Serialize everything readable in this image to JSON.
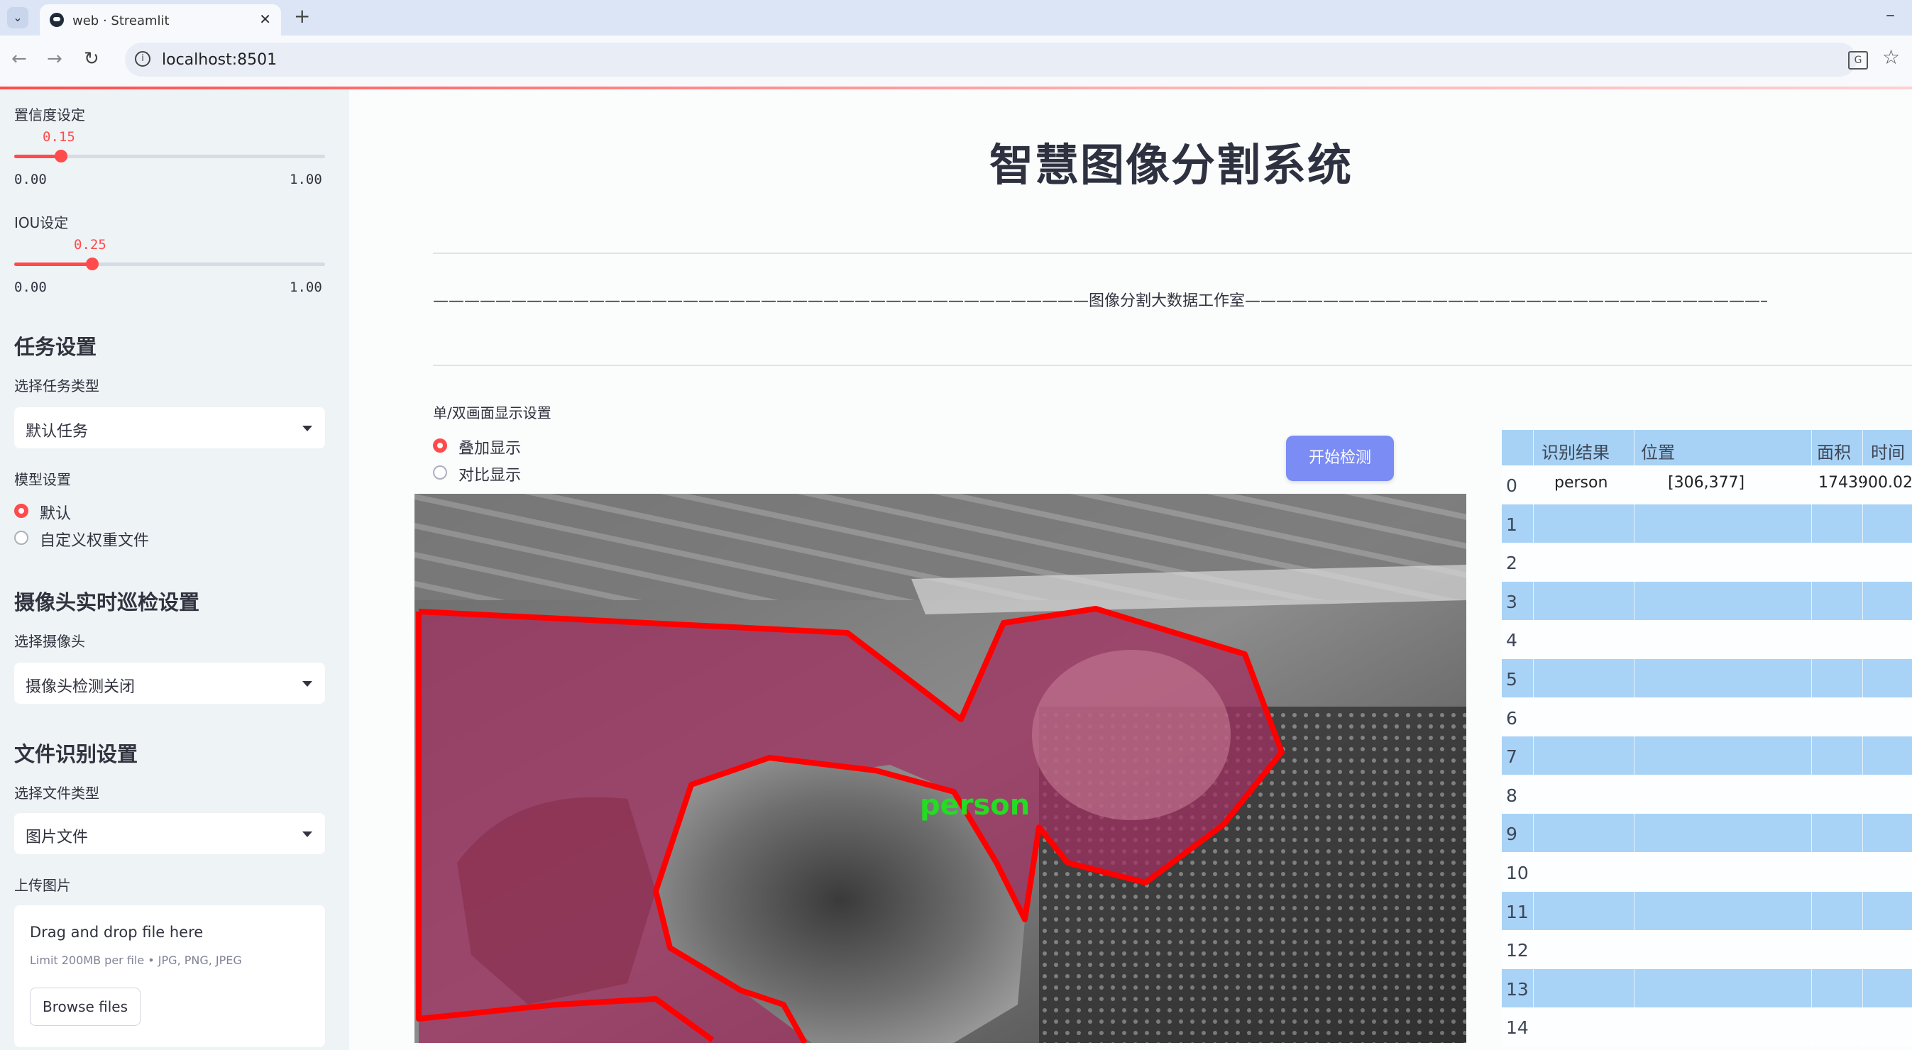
{
  "browser": {
    "tab_title": "web · Streamlit",
    "url": "localhost:8501"
  },
  "sidebar": {
    "confidence": {
      "label": "置信度设定",
      "value": "0.15",
      "min": "0.00",
      "max": "1.00",
      "fraction": 0.15
    },
    "iou": {
      "label": "IOU设定",
      "value": "0.25",
      "min": "0.00",
      "max": "1.00",
      "fraction": 0.25
    },
    "task_header": "任务设置",
    "task_type_label": "选择任务类型",
    "task_type_value": "默认任务",
    "model_label": "模型设置",
    "model_options": [
      "默认",
      "自定义权重文件"
    ],
    "camera_header": "摄像头实时巡检设置",
    "camera_label": "选择摄像头",
    "camera_value": "摄像头检测关闭",
    "file_header": "文件识别设置",
    "file_type_label": "选择文件类型",
    "file_type_value": "图片文件",
    "upload_label": "上传图片",
    "upload_title": "Drag and drop file here",
    "upload_sub": "Limit 200MB per file • JPG, PNG, JPEG",
    "browse_label": "Browse files"
  },
  "main": {
    "title": "智慧图像分割系统",
    "studio_line": "——————————————————————————————————————————图像分割大数据工作室——————————————————————————————————————————",
    "display_label": "单/双画面显示设置",
    "display_options": [
      "叠加显示",
      "对比显示"
    ],
    "start_button": "开始检测",
    "detection_label": "person"
  },
  "table": {
    "columns": [
      "识别结果",
      "位置",
      "面积",
      "时间"
    ],
    "rows": [
      {
        "idx": "0",
        "result": "person",
        "position": "[306,377]",
        "area": "1743900.02"
      },
      {
        "idx": "1"
      },
      {
        "idx": "2"
      },
      {
        "idx": "3"
      },
      {
        "idx": "4"
      },
      {
        "idx": "5"
      },
      {
        "idx": "6"
      },
      {
        "idx": "7"
      },
      {
        "idx": "8"
      },
      {
        "idx": "9"
      },
      {
        "idx": "10"
      },
      {
        "idx": "11"
      },
      {
        "idx": "12"
      },
      {
        "idx": "13"
      },
      {
        "idx": "14"
      }
    ]
  },
  "colors": {
    "accent": "#ff4b4b",
    "button": "#7b8cf4",
    "table_stripe": "#a9d3f6",
    "mask": "#a03060",
    "outline": "#ff0000",
    "label_green": "#22dd22"
  }
}
